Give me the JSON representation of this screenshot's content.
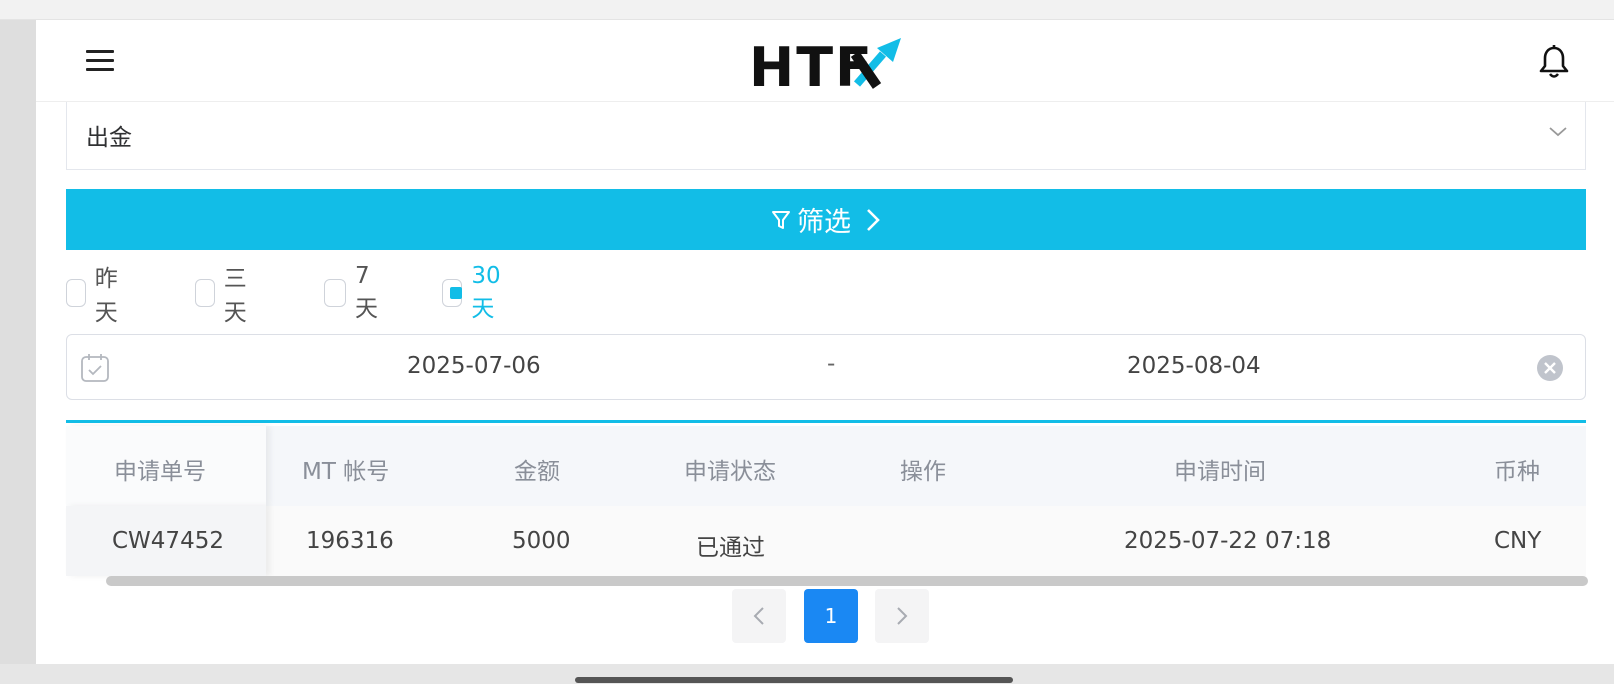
{
  "header": {
    "logo_text": "HTF",
    "logo_mark": "X",
    "menu_icon": "hamburger-icon",
    "notify_icon": "bell-icon"
  },
  "filter": {
    "type_value": "出金",
    "filter_button_label": "筛选",
    "quick_ranges": [
      {
        "label": "昨天",
        "checked": false
      },
      {
        "label": "三天",
        "checked": false
      },
      {
        "label": "7天",
        "checked": false
      },
      {
        "label": "30天",
        "checked": true
      }
    ],
    "date_start": "2025-07-06",
    "date_separator": "-",
    "date_end": "2025-08-04"
  },
  "table": {
    "columns": [
      "申请单号",
      "MT 帐号",
      "金额",
      "申请状态",
      "操作",
      "申请时间",
      "币种"
    ],
    "rows": [
      [
        "CW47452",
        "196316",
        "5000",
        "已通过",
        "",
        "2025-07-22 07:18",
        "CNY"
      ]
    ]
  },
  "pagination": {
    "current_page": "1"
  },
  "colors": {
    "accent": "#12bde7",
    "page_active": "#1a88f3"
  }
}
